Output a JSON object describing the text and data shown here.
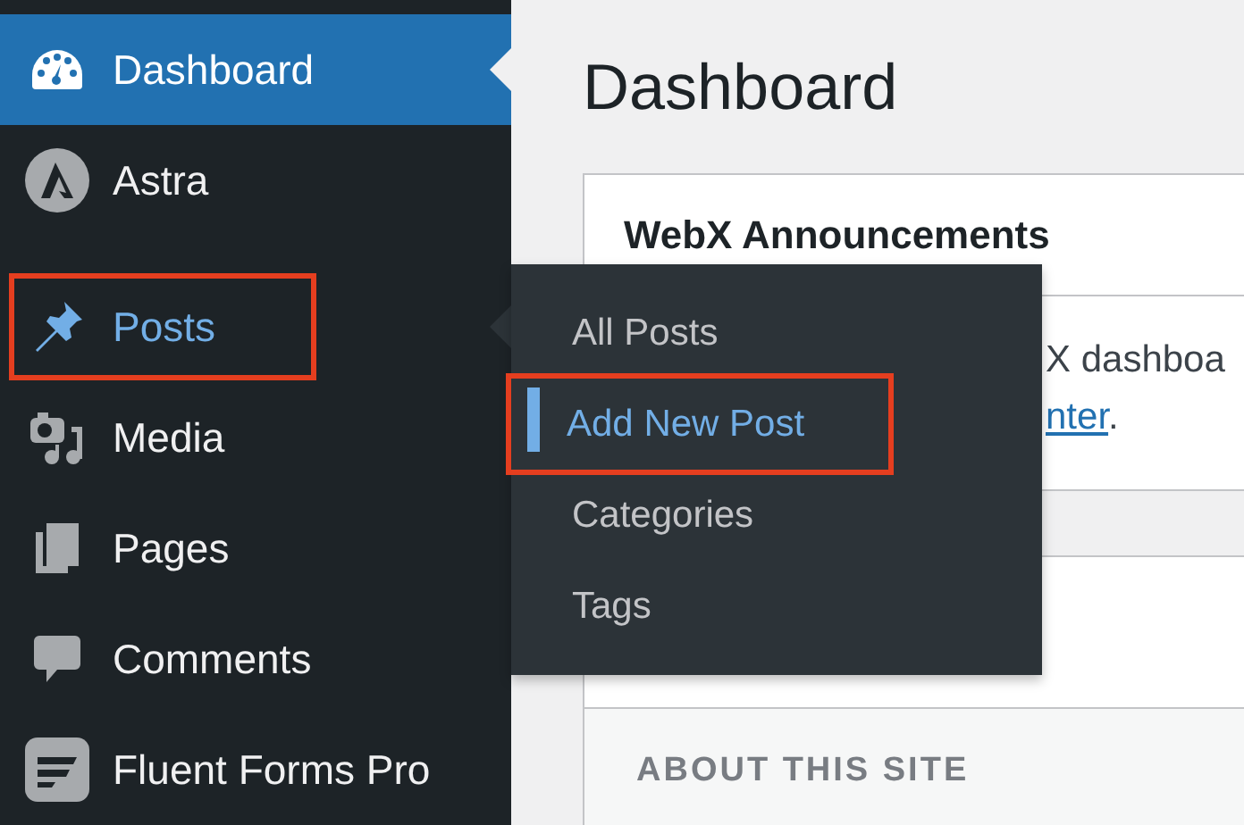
{
  "sidebar": {
    "items": [
      {
        "label": "Dashboard",
        "current": true,
        "open": false,
        "highlighted": false
      },
      {
        "label": "Astra",
        "current": false,
        "open": false,
        "highlighted": false
      },
      {
        "label": "Posts",
        "current": false,
        "open": true,
        "highlighted": true
      },
      {
        "label": "Media",
        "current": false,
        "open": false,
        "highlighted": false
      },
      {
        "label": "Pages",
        "current": false,
        "open": false,
        "highlighted": false
      },
      {
        "label": "Comments",
        "current": false,
        "open": false,
        "highlighted": false
      },
      {
        "label": "Fluent Forms Pro",
        "current": false,
        "open": false,
        "highlighted": false
      }
    ]
  },
  "flyout": {
    "items": [
      {
        "label": "All Posts",
        "selected": false,
        "highlighted": false
      },
      {
        "label": "Add New Post",
        "selected": true,
        "highlighted": true
      },
      {
        "label": "Categories",
        "selected": false,
        "highlighted": false
      },
      {
        "label": "Tags",
        "selected": false,
        "highlighted": false
      }
    ]
  },
  "page": {
    "title": "Dashboard"
  },
  "announcements": {
    "title": "WebX Announcements",
    "lines": [
      {
        "text": "X dashboa"
      },
      {
        "link": "nter",
        "text": "."
      }
    ]
  },
  "site_card": {
    "section": "ABOUT THIS SITE"
  }
}
